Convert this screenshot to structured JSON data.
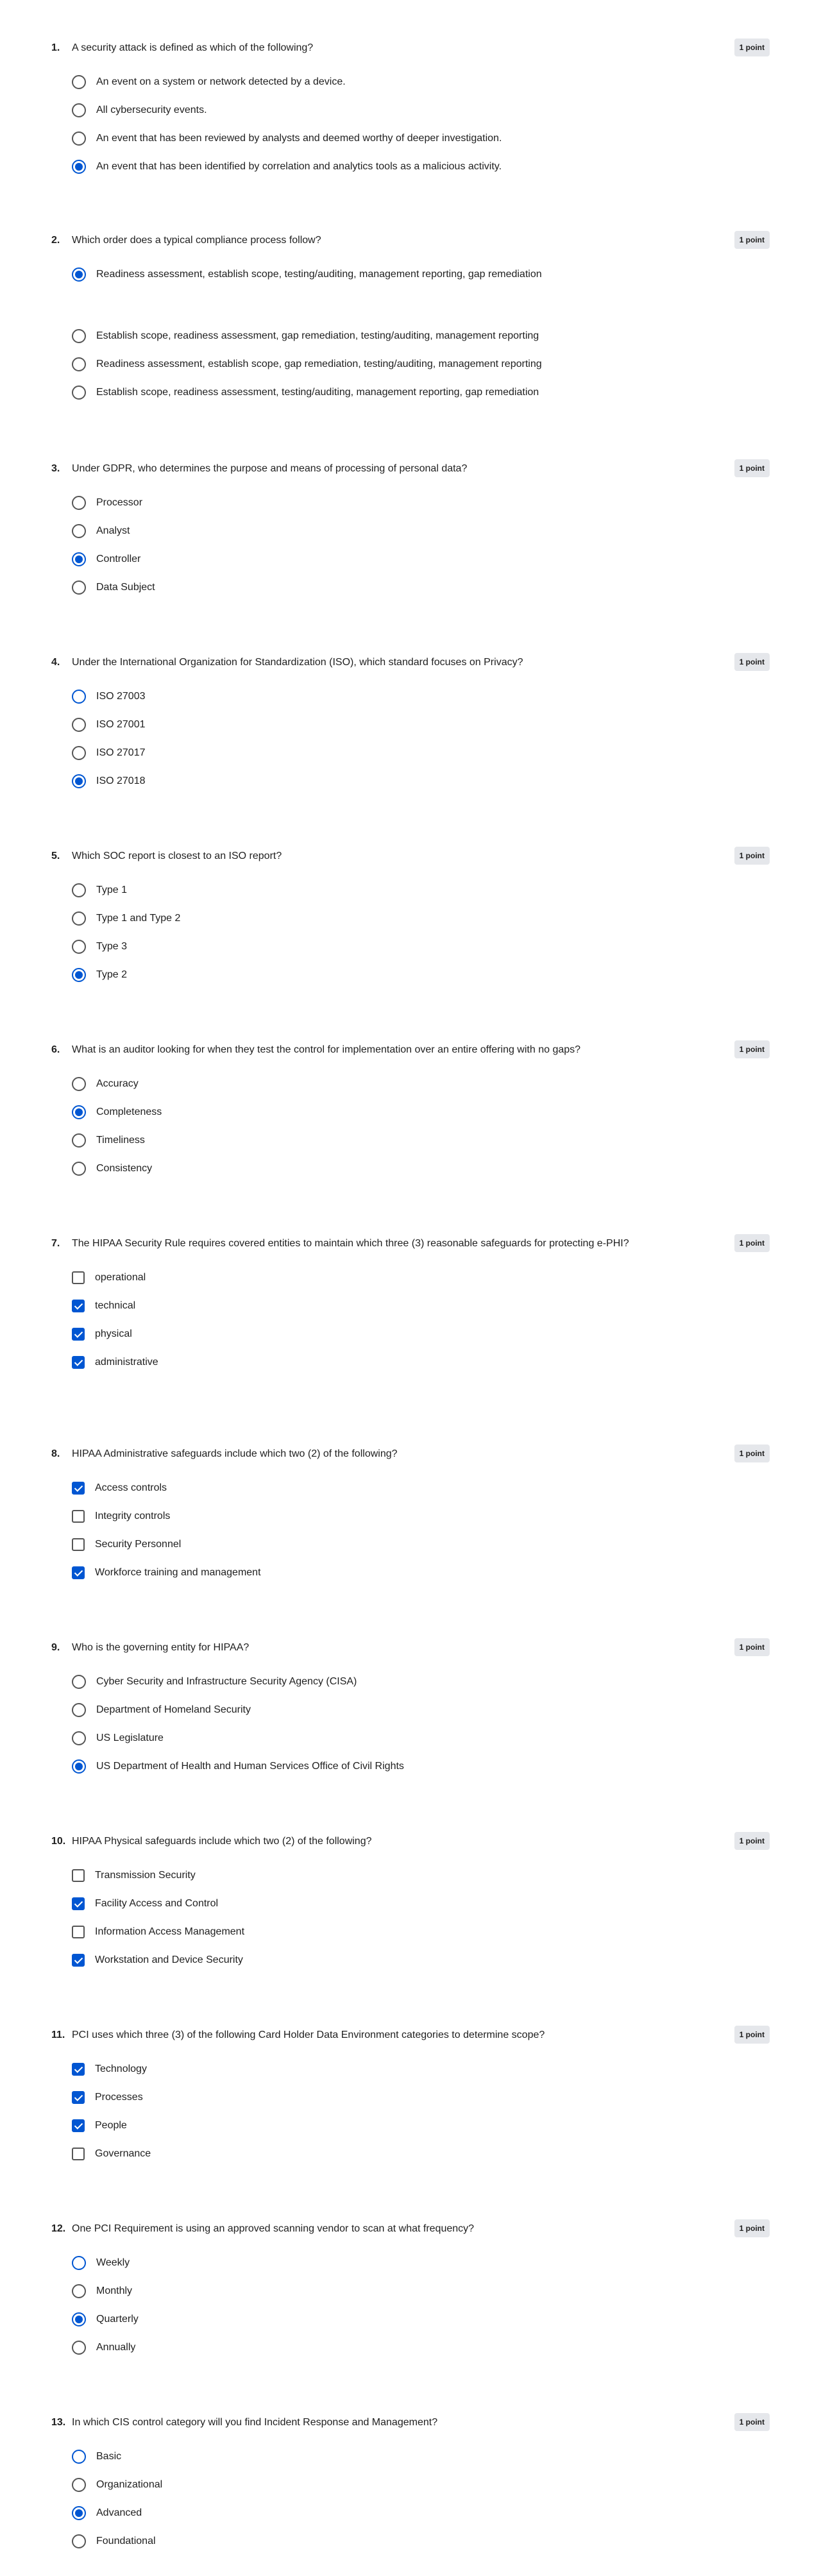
{
  "questions": [
    {
      "number": "1.",
      "text": "A security attack is defined as which of the following?",
      "points": "1 point",
      "type": "radio",
      "options": [
        {
          "label": "An event on a system or network detected by a device.",
          "selected": false
        },
        {
          "label": "All cybersecurity events.",
          "selected": false
        },
        {
          "label": "An event that has been reviewed by analysts and deemed worthy of deeper investigation.",
          "selected": false
        },
        {
          "label": "An event that has been identified by correlation and analytics tools as a malicious activity.",
          "selected": true
        }
      ]
    },
    {
      "number": "2.",
      "text": "Which order does a typical compliance process follow?",
      "points": "1 point",
      "type": "radio",
      "options": [
        {
          "label": "Readiness assessment, establish scope, testing/auditing, management reporting, gap remediation",
          "selected": true
        },
        {
          "label": "Establish scope, readiness assessment, gap remediation, testing/auditing, management reporting",
          "selected": false
        },
        {
          "label": "Readiness assessment, establish scope, gap remediation, testing/auditing, management reporting",
          "selected": false
        },
        {
          "label": "Establish scope, readiness assessment, testing/auditing, management reporting, gap remediation",
          "selected": false
        }
      ]
    },
    {
      "number": "3.",
      "text": "Under GDPR, who determines the purpose and means of processing of personal data?",
      "points": "1 point",
      "type": "radio",
      "options": [
        {
          "label": "Processor",
          "selected": false
        },
        {
          "label": "Analyst",
          "selected": false
        },
        {
          "label": "Controller",
          "selected": true
        },
        {
          "label": "Data Subject",
          "selected": false
        }
      ]
    },
    {
      "number": "4.",
      "text": "Under the International Organization for Standardization (ISO), which standard focuses on Privacy?",
      "points": "1 point",
      "type": "radio",
      "options": [
        {
          "label": "ISO 27003",
          "selected": false
        },
        {
          "label": "ISO 27001",
          "selected": false
        },
        {
          "label": "ISO 27017",
          "selected": false
        },
        {
          "label": "ISO 27018",
          "selected": true
        }
      ]
    },
    {
      "number": "5.",
      "text": "Which SOC report is closest to an ISO report?",
      "points": "1 point",
      "type": "radio",
      "options": [
        {
          "label": "Type 1",
          "selected": false
        },
        {
          "label": "Type 1 and Type 2",
          "selected": false
        },
        {
          "label": "Type 3",
          "selected": false
        },
        {
          "label": "Type 2",
          "selected": true
        }
      ]
    },
    {
      "number": "6.",
      "text": "What is an auditor looking for when they test the control for implementation over an entire offering with no gaps?",
      "points": "1 point",
      "type": "radio",
      "options": [
        {
          "label": "Accuracy",
          "selected": false
        },
        {
          "label": "Completeness",
          "selected": true
        },
        {
          "label": "Timeliness",
          "selected": false
        },
        {
          "label": "Consistency",
          "selected": false
        }
      ]
    },
    {
      "number": "7.",
      "text": "The HIPAA Security Rule requires covered entities to maintain which three (3) reasonable safeguards for protecting e-PHI?",
      "points": "1 point",
      "type": "checkbox",
      "options": [
        {
          "label": "operational",
          "selected": false
        },
        {
          "label": "technical",
          "selected": true
        },
        {
          "label": "physical",
          "selected": true
        },
        {
          "label": "administrative",
          "selected": true
        }
      ]
    },
    {
      "number": "8.",
      "text": "HIPAA Administrative safeguards include which two (2) of the following?",
      "points": "1 point",
      "type": "checkbox",
      "options": [
        {
          "label": "Access controls",
          "selected": true
        },
        {
          "label": "Integrity controls",
          "selected": false
        },
        {
          "label": "Security Personnel",
          "selected": false
        },
        {
          "label": "Workforce training and management",
          "selected": true
        }
      ]
    },
    {
      "number": "9.",
      "text": "Who is the governing entity for HIPAA?",
      "points": "1 point",
      "type": "radio",
      "options": [
        {
          "label": "Cyber Security and Infrastructure Security Agency (CISA)",
          "selected": false
        },
        {
          "label": "Department of Homeland Security",
          "selected": false
        },
        {
          "label": "US Legislature",
          "selected": false
        },
        {
          "label": "US Department of Health and Human Services Office of Civil Rights",
          "selected": true
        }
      ]
    },
    {
      "number": "10.",
      "text": "HIPAA Physical safeguards include which two (2) of the following?",
      "points": "1 point",
      "type": "checkbox",
      "options": [
        {
          "label": "Transmission Security",
          "selected": false
        },
        {
          "label": "Facility Access and Control",
          "selected": true
        },
        {
          "label": "Information Access Management",
          "selected": false
        },
        {
          "label": "Workstation and Device Security",
          "selected": true
        }
      ]
    },
    {
      "number": "11.",
      "text": "PCI uses which three (3) of the following Card Holder Data Environment categories to determine scope?",
      "points": "1 point",
      "type": "checkbox",
      "options": [
        {
          "label": "Technology",
          "selected": true
        },
        {
          "label": "Processes",
          "selected": true
        },
        {
          "label": "People",
          "selected": true
        },
        {
          "label": "Governance",
          "selected": false
        }
      ]
    },
    {
      "number": "12.",
      "text": "One PCI Requirement is using an approved scanning vendor to scan at what frequency?",
      "points": "1 point",
      "type": "radio",
      "options": [
        {
          "label": "Weekly",
          "selected": false
        },
        {
          "label": "Monthly",
          "selected": false
        },
        {
          "label": "Quarterly",
          "selected": true
        },
        {
          "label": "Annually",
          "selected": false
        }
      ]
    },
    {
      "number": "13.",
      "text": "In which CIS control category will you find Incident Response and Management?",
      "points": "1 point",
      "type": "radio",
      "options": [
        {
          "label": "Basic",
          "selected": false
        },
        {
          "label": "Organizational",
          "selected": false
        },
        {
          "label": "Advanced",
          "selected": true
        },
        {
          "label": "Foundational",
          "selected": false
        }
      ]
    }
  ],
  "colors": {
    "accent": "#0056d2",
    "badge_bg": "#e5e7eb",
    "text": "#1f1f1f"
  }
}
